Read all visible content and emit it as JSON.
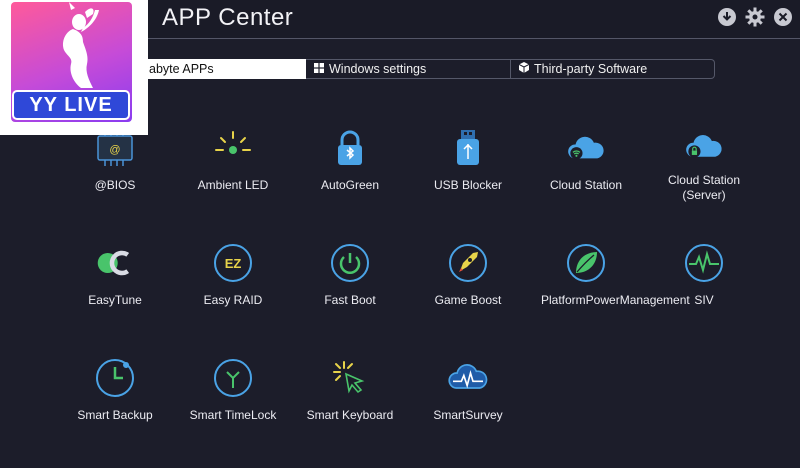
{
  "window": {
    "title": "APP Center"
  },
  "titlebar_icons": [
    "download-icon",
    "gear-icon",
    "close-icon"
  ],
  "logo": {
    "text": "YY LIVE",
    "colors": {
      "gradient_start": "#ff5a9a",
      "gradient_end": "#8a3cf0",
      "badge": "#2f48d8"
    }
  },
  "tabs": [
    {
      "label": "abyte APPs",
      "active": true
    },
    {
      "label": "Windows settings",
      "icon": "windows-icon"
    },
    {
      "label": "Third-party Software",
      "icon": "box-icon"
    }
  ],
  "apps": [
    {
      "label": "@BIOS",
      "icon": "bios-chip-icon"
    },
    {
      "label": "Ambient LED",
      "icon": "led-light-icon"
    },
    {
      "label": "AutoGreen",
      "icon": "bluetooth-lock-icon"
    },
    {
      "label": "USB Blocker",
      "icon": "usb-icon"
    },
    {
      "label": "Cloud Station",
      "icon": "cloud-wifi-icon"
    },
    {
      "label": "Cloud Station (Server)",
      "icon": "cloud-lock-icon"
    },
    {
      "label": "EasyTune",
      "icon": "easytune-icon"
    },
    {
      "label": "Easy RAID",
      "icon": "ez-raid-icon"
    },
    {
      "label": "Fast Boot",
      "icon": "power-refresh-icon"
    },
    {
      "label": "Game Boost",
      "icon": "rocket-icon"
    },
    {
      "label": "PlatformPowerManagement",
      "icon": "leaf-icon"
    },
    {
      "label": "SIV",
      "icon": "pulse-icon"
    },
    {
      "label": "Smart Backup",
      "icon": "clock-icon"
    },
    {
      "label": "Smart TimeLock",
      "icon": "timelock-icon"
    },
    {
      "label": "Smart Keyboard",
      "icon": "cursor-click-icon"
    },
    {
      "label": "SmartSurvey",
      "icon": "cloud-pulse-icon"
    }
  ],
  "colors": {
    "background": "#1c1d2a",
    "accent_green": "#49c46b",
    "accent_blue": "#4aa3e6",
    "accent_yellow": "#e7d34a"
  }
}
